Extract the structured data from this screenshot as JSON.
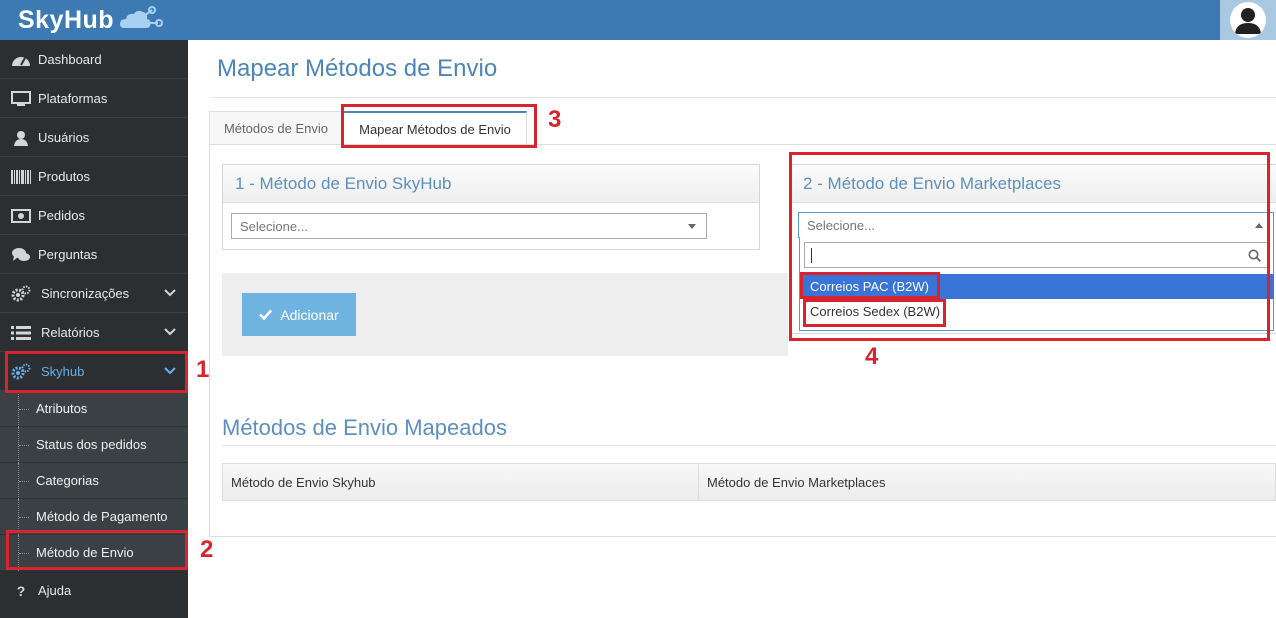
{
  "app": {
    "name": "SkyHub"
  },
  "sidebar": {
    "items": [
      {
        "label": "Dashboard",
        "icon": "tachometer-icon"
      },
      {
        "label": "Plataformas",
        "icon": "monitor-icon"
      },
      {
        "label": "Usuários",
        "icon": "user-icon"
      },
      {
        "label": "Produtos",
        "icon": "barcode-icon"
      },
      {
        "label": "Pedidos",
        "icon": "money-icon"
      },
      {
        "label": "Perguntas",
        "icon": "chat-icon"
      },
      {
        "label": "Sincronizações",
        "icon": "gears-icon"
      },
      {
        "label": "Relatórios",
        "icon": "list-icon"
      },
      {
        "label": "Skyhub",
        "icon": "gears-icon"
      }
    ],
    "subitems": [
      {
        "label": "Atributos"
      },
      {
        "label": "Status dos pedidos"
      },
      {
        "label": "Categorias"
      },
      {
        "label": "Método de Pagamento"
      },
      {
        "label": "Método de Envio"
      }
    ],
    "help": {
      "label": "Ajuda",
      "icon": "question-icon"
    }
  },
  "main": {
    "title": "Mapear Métodos de Envio",
    "tabs": [
      {
        "label": "Métodos de Envio"
      },
      {
        "label": "Mapear Métodos de Envio"
      }
    ],
    "skyhub_widget": {
      "title": "1 - Método de Envio SkyHub",
      "select_placeholder": "Selecione..."
    },
    "marketplace_widget": {
      "title": "2 - Método de Envio Marketplaces",
      "select_placeholder": "Selecione...",
      "search_value": "",
      "options": [
        {
          "label": "Correios PAC (B2W)",
          "highlighted": true
        },
        {
          "label": "Correios Sedex (B2W)",
          "highlighted": false
        }
      ]
    },
    "add_button": {
      "label": "Adicionar"
    },
    "mapped_section": {
      "title": "Métodos de Envio Mapeados",
      "columns": [
        "Método de Envio Skyhub",
        "Método de Envio Marketplaces"
      ]
    }
  },
  "annotations": [
    "1",
    "2",
    "3",
    "4"
  ],
  "colors": {
    "topbar": "#3d7ab3",
    "sidebar": "#2b2f32",
    "accent": "#4d85b9",
    "annotation": "#d9232e",
    "highlight": "#3875d7"
  }
}
